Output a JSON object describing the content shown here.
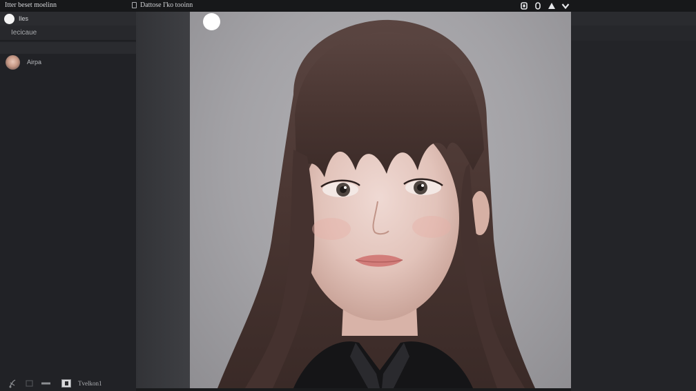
{
  "topbar": {
    "app_title": "Itter beset moelinn",
    "file_title": "Dattose I'ko tooinn"
  },
  "window_controls": [
    {
      "name": "copy-icon"
    },
    {
      "name": "info-icon"
    },
    {
      "name": "warning-icon"
    },
    {
      "name": "chevron-down-icon"
    }
  ],
  "sidebar": {
    "header_label": "Iles",
    "section_label": "Iecicaue",
    "contacts": [
      {
        "name": "Airpa"
      }
    ],
    "footer": {
      "label": "Tvelkon1"
    }
  },
  "colors": {
    "background": "#1f2023",
    "topbar": "#17181a",
    "sidebar": "#212226",
    "photo_background": "#a6a5a9",
    "hair": "#4a3632"
  }
}
